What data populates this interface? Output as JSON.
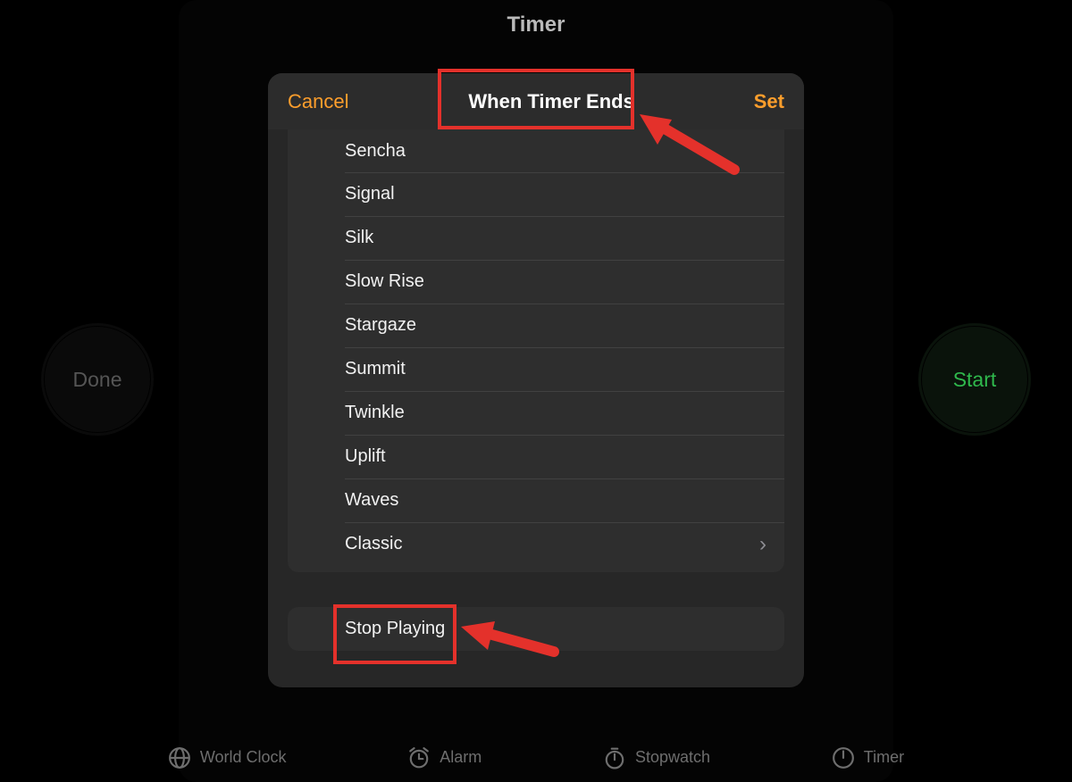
{
  "page": {
    "title": "Timer"
  },
  "buttons": {
    "done": "Done",
    "start": "Start"
  },
  "tabs": {
    "world_clock": "World Clock",
    "alarm": "Alarm",
    "stopwatch": "Stopwatch",
    "timer": "Timer"
  },
  "sheet": {
    "cancel": "Cancel",
    "title": "When Timer Ends",
    "set": "Set",
    "stop_playing": "Stop Playing",
    "sounds": [
      "Sencha",
      "Signal",
      "Silk",
      "Slow Rise",
      "Stargaze",
      "Summit",
      "Twinkle",
      "Uplift",
      "Waves",
      "Classic"
    ]
  },
  "annotations": {
    "highlight_title": true,
    "highlight_stop_playing": true
  },
  "colors": {
    "accent": "#fd9e2c",
    "annotation": "#e4312b",
    "start_green": "#2fb84c"
  }
}
